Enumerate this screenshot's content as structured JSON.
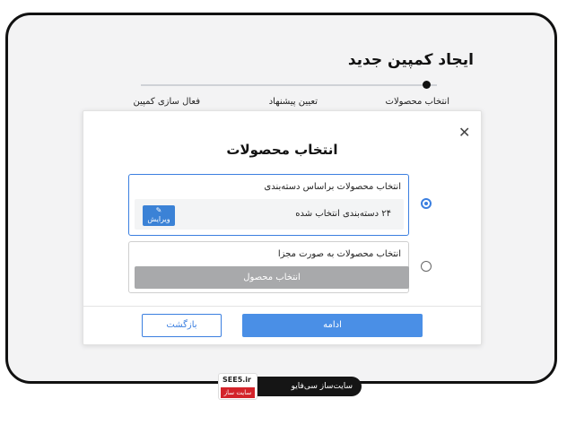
{
  "page": {
    "title": "ایجاد کمپین جدید"
  },
  "stepper": {
    "steps": [
      {
        "label": "انتخاب محصولات",
        "active": true
      },
      {
        "label": "تعیین پیشنهاد",
        "active": false
      },
      {
        "label": "فعال سازی کمپین",
        "active": false
      }
    ]
  },
  "modal": {
    "close_icon": "close-icon",
    "title": "انتخاب محصولات",
    "options": [
      {
        "label": "انتخاب محصولات براساس دسته‌بندی",
        "selected": true,
        "summary": "۲۴ دسته‌بندی انتخاب شده",
        "edit_label": "ویرایش",
        "edit_icon": "pencil-icon"
      },
      {
        "label": "انتخاب محصولات به صورت مجزا",
        "selected": false,
        "button_label": "انتخاب محصول"
      }
    ],
    "continue_label": "ادامه",
    "back_label": "بازگشت"
  },
  "watermark": {
    "brand": "SEE5.ir",
    "brand_sub": "سایت ساز",
    "tagline": "سایت‌ساز سی‌فایو"
  },
  "colors": {
    "accent": "#3b7fe0",
    "continue_bg": "#4a8fe6",
    "disabled_bg": "#a8a9ab",
    "watermark_red": "#d3232a"
  }
}
